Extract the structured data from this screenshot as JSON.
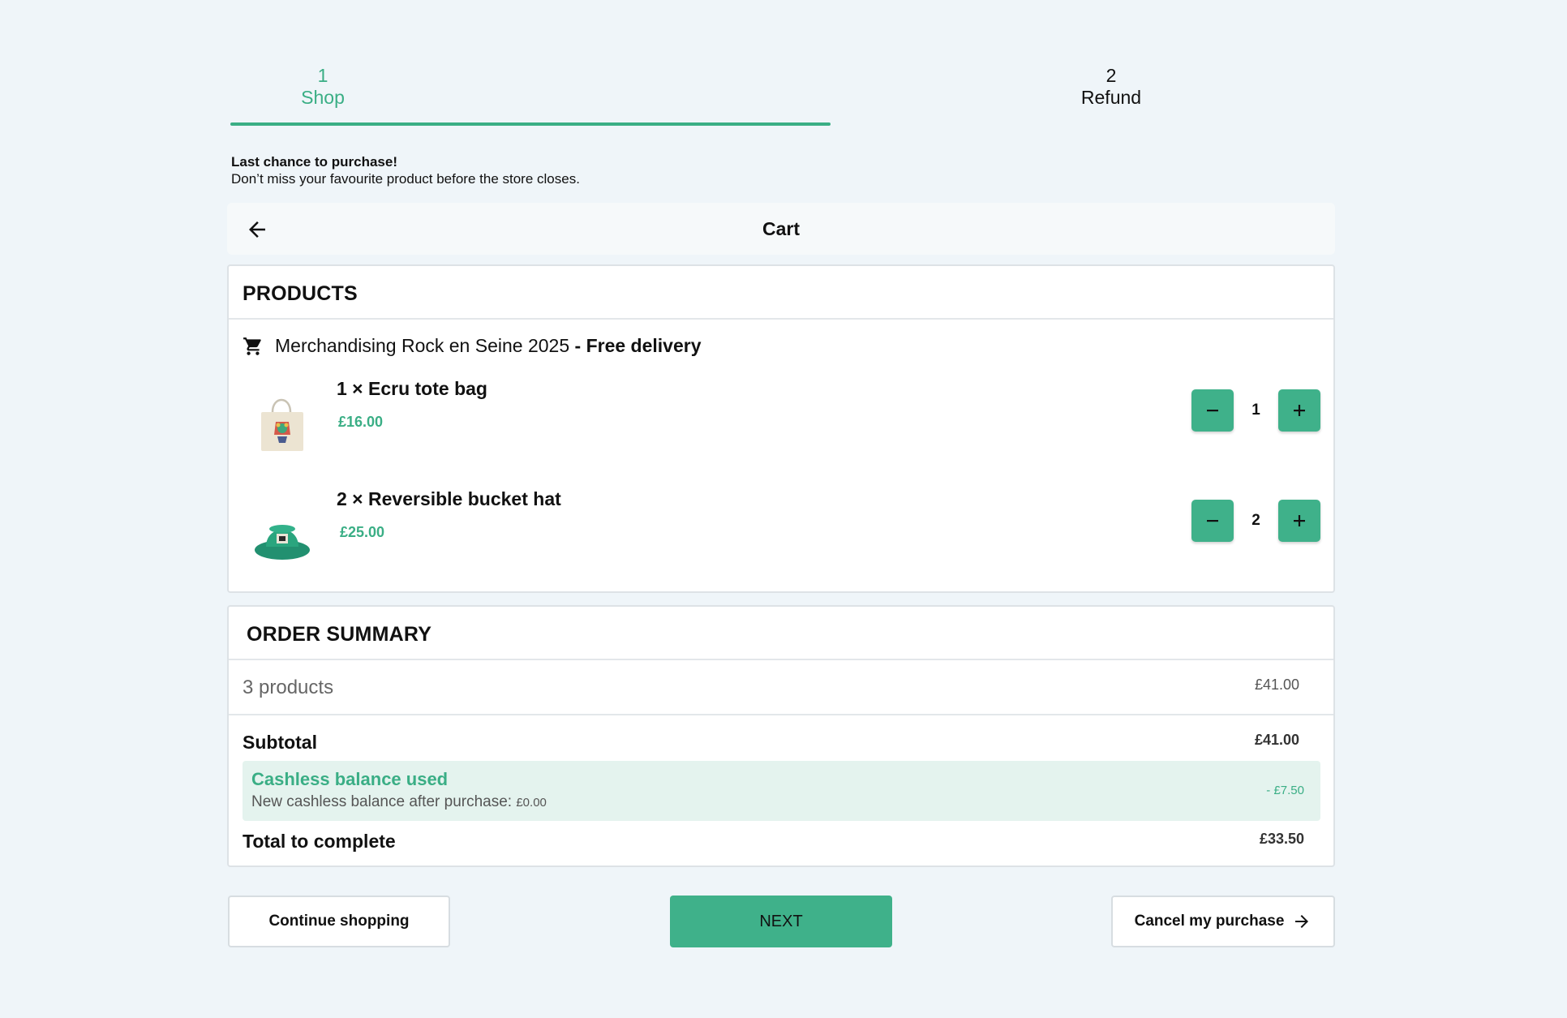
{
  "stepper": {
    "steps": [
      {
        "number": "1",
        "label": "Shop",
        "active": true
      },
      {
        "number": "2",
        "label": "Refund",
        "active": false
      }
    ]
  },
  "notice": {
    "title": "Last chance to purchase!",
    "subtitle": "Don’t miss your favourite product before the store closes."
  },
  "cart": {
    "title": "Cart",
    "back_icon": "arrow-left-icon"
  },
  "products": {
    "heading": "PRODUCTS",
    "vendor_icon": "cart-icon",
    "vendor_name": "Merchandising Rock en Seine 2025",
    "vendor_delivery": " - Free delivery",
    "items": [
      {
        "name": "1 × Ecru tote bag",
        "price": "£16.00",
        "quantity": "1",
        "image": "tote-bag-image"
      },
      {
        "name": "2 × Reversible bucket hat",
        "price": "£25.00",
        "quantity": "2",
        "image": "bucket-hat-image"
      }
    ]
  },
  "summary": {
    "heading": "ORDER SUMMARY",
    "products_label": "3 products",
    "products_value": "£41.00",
    "subtotal_label": "Subtotal",
    "subtotal_value": "£41.00",
    "cashless_title": "Cashless balance used",
    "cashless_sub": "New cashless balance after purchase: ",
    "cashless_new_balance": "£0.00",
    "cashless_value": "- £7.50",
    "total_label": "Total to complete",
    "total_value": "£33.50"
  },
  "actions": {
    "continue_label": "Continue shopping",
    "next_label": "NEXT",
    "cancel_label": "Cancel my purchase"
  },
  "colors": {
    "accent": "#3fb18a",
    "accent_text": "#3aae85",
    "background": "#eff5f9",
    "cashless_bg": "#e4f3ee"
  }
}
